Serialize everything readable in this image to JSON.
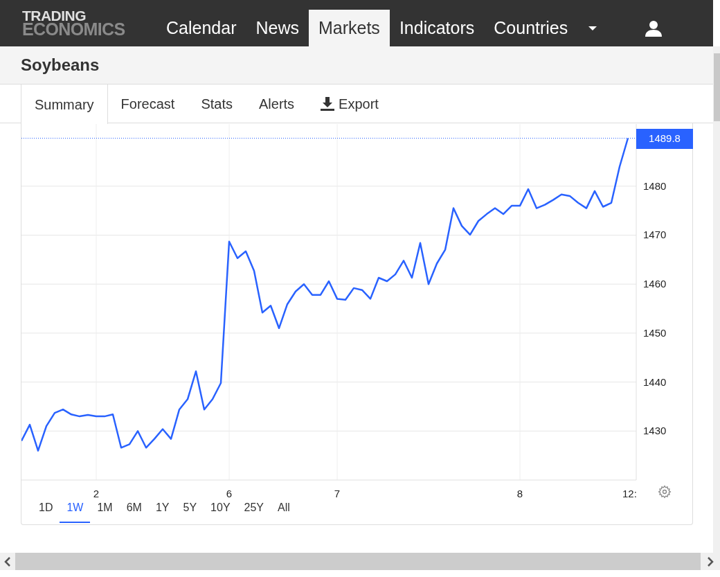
{
  "logo": {
    "line_1": "TRADING",
    "line_2": "ECONOMICS"
  },
  "nav": [
    {
      "label": "Calendar",
      "selected": false
    },
    {
      "label": "News",
      "selected": false
    },
    {
      "label": "Markets",
      "selected": true
    },
    {
      "label": "Indicators",
      "selected": false
    },
    {
      "label": "Countries",
      "selected": false
    }
  ],
  "page_title": "Soybeans",
  "tabs": [
    {
      "label": "Summary",
      "selected": true,
      "kind": "tab"
    },
    {
      "label": "Forecast",
      "selected": false,
      "kind": "tab"
    },
    {
      "label": "Stats",
      "selected": false,
      "kind": "tab"
    },
    {
      "label": "Alerts",
      "selected": false,
      "kind": "tab"
    },
    {
      "label": "Export",
      "selected": false,
      "kind": "download"
    }
  ],
  "chart": {
    "last_price_label": "1489.8",
    "cut_time_label": "12:",
    "chart_data": {
      "type": "line",
      "ylim": [
        1420,
        1492.7
      ],
      "yticks": [
        1430,
        1440,
        1450,
        1460,
        1470,
        1480
      ],
      "categories": [
        null,
        null,
        null,
        null,
        null,
        null,
        null,
        null,
        null,
        "2",
        null,
        null,
        null,
        null,
        null,
        null,
        null,
        null,
        null,
        null,
        null,
        null,
        null,
        null,
        null,
        "6",
        null,
        null,
        null,
        null,
        null,
        null,
        null,
        null,
        null,
        null,
        null,
        null,
        "7",
        null,
        null,
        null,
        null,
        null,
        null,
        null,
        null,
        null,
        null,
        null,
        null,
        null,
        null,
        null,
        null,
        null,
        null,
        null,
        null,
        null,
        "8",
        null,
        null,
        null,
        null,
        null,
        null,
        null,
        null,
        null,
        null,
        null,
        null,
        null
      ],
      "grid": true,
      "ref_lines": [
        {
          "axis": "y",
          "value": 1489.8
        }
      ],
      "series": [
        {
          "color": "#2962ff",
          "values": [
            1428,
            1431.3,
            1426,
            1431,
            1433.7,
            1434.4,
            1433.4,
            1433,
            1433.3,
            1433,
            1433,
            1433.4,
            1426.6,
            1427.3,
            1430,
            1426.6,
            1428.4,
            1430.4,
            1428.4,
            1434.4,
            1436.5,
            1442.2,
            1434.4,
            1436.5,
            1439.8,
            1468.7,
            1465.3,
            1466.7,
            1462.7,
            1454.2,
            1455.6,
            1451,
            1455.9,
            1458.5,
            1460,
            1457.8,
            1457.8,
            1460.6,
            1457,
            1456.8,
            1459.2,
            1458.8,
            1457,
            1461.3,
            1460.6,
            1462,
            1464.8,
            1461.3,
            1468.4,
            1460,
            1464.2,
            1467,
            1475.5,
            1471.9,
            1470.1,
            1472.9,
            1474.3,
            1475.5,
            1474.3,
            1476,
            1476,
            1479.4,
            1475.5,
            1476.2,
            1477.2,
            1478.3,
            1478,
            1476.6,
            1475.5,
            1479,
            1475.8,
            1476.6,
            1484,
            1489.8
          ]
        }
      ]
    }
  },
  "ranges": [
    {
      "label": "1D",
      "selected": false
    },
    {
      "label": "1W",
      "selected": true
    },
    {
      "label": "1M",
      "selected": false
    },
    {
      "label": "6M",
      "selected": false
    },
    {
      "label": "1Y",
      "selected": false
    },
    {
      "label": "5Y",
      "selected": false
    },
    {
      "label": "10Y",
      "selected": false
    },
    {
      "label": "25Y",
      "selected": false
    },
    {
      "label": "All",
      "selected": false
    }
  ]
}
